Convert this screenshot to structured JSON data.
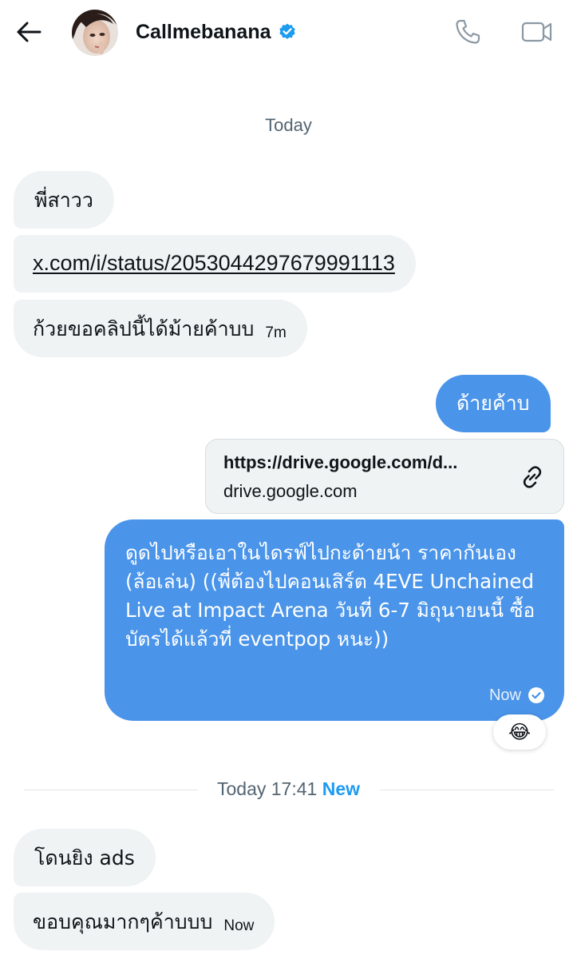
{
  "header": {
    "title": "Callmebanana",
    "verified": true,
    "icons": [
      "back-arrow-icon",
      "verified-badge-icon",
      "phone-icon",
      "video-camera-icon"
    ]
  },
  "date_separator": "Today",
  "messages_in_1": [
    {
      "text": "พี่สาวว"
    },
    {
      "text": "x.com/i/status/2053044297679991113"
    },
    {
      "text": "ก้วยขอคลิปนี้ได้ม้ายค้าบบ",
      "time": "7m"
    }
  ],
  "messages_out": [
    {
      "text": "ด้ายค้าบ"
    }
  ],
  "link_card": {
    "url": "https://drive.google.com/d...",
    "domain": "drive.google.com"
  },
  "long_message": {
    "text": "ดูดไปหรือเอาในไดรฟ์ไปกะด้ายน้า ราคากันเอง (ล้อเล่น) ((พี่ต้องไปคอนเสิร์ต 4EVE Unchained Live at Impact Arena วันที่ 6-7 มิถุนายนนี้ ซื้อบัตรได้แล้วที่ eventpop หนะ))",
    "time": "Now",
    "reaction": "😂"
  },
  "new_divider": {
    "time": "Today 17:41",
    "label": "New"
  },
  "messages_in_2": [
    {
      "text": "โดนยิง ads"
    },
    {
      "text": "ขอบคุณมากๆค้าบบบ",
      "time": "Now"
    }
  ],
  "colors": {
    "outgoing_bubble": "#4a94e9",
    "incoming_bubble": "#eff3f4",
    "accent": "#1d9bf0",
    "muted_text": "#536471"
  }
}
